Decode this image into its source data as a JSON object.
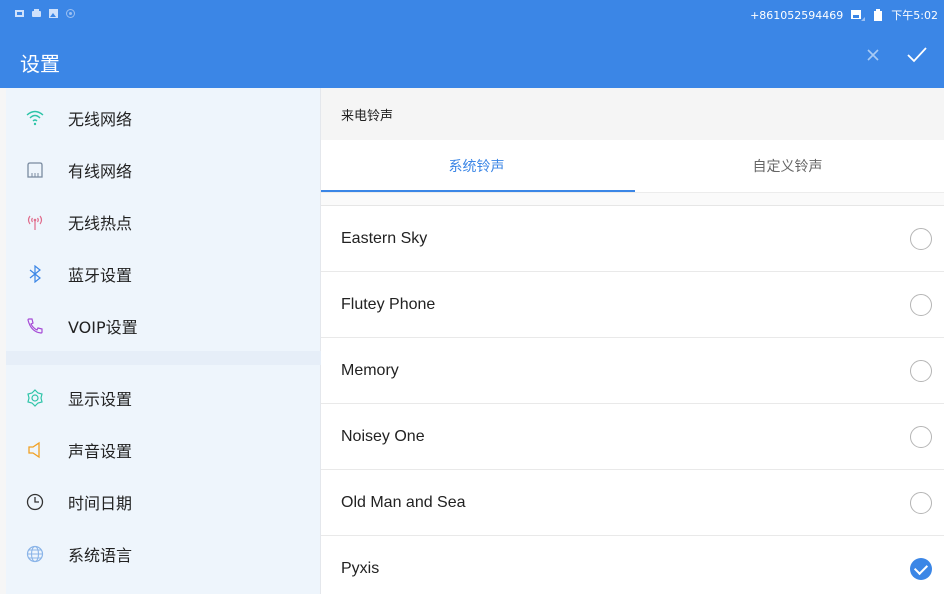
{
  "status_bar": {
    "phone_number": "+861052594469",
    "time": "下午5:02"
  },
  "header": {
    "title": "设置",
    "close_icon": "close-icon",
    "confirm_icon": "check-icon"
  },
  "sidebar": {
    "items": [
      {
        "label": "无线网络",
        "icon": "wifi-icon",
        "color": "#2ec4a8"
      },
      {
        "label": "有线网络",
        "icon": "ethernet-icon",
        "color": "#7a8ba0"
      },
      {
        "label": "无线热点",
        "icon": "hotspot-icon",
        "color": "#e06b8b"
      },
      {
        "label": "蓝牙设置",
        "icon": "bluetooth-icon",
        "color": "#3b86e6"
      },
      {
        "label": "VOIP设置",
        "icon": "phone-icon",
        "color": "#a64ad6"
      },
      {
        "label": "显示设置",
        "icon": "display-icon",
        "color": "#2ec4a8"
      },
      {
        "label": "声音设置",
        "icon": "speaker-icon",
        "color": "#f0a022"
      },
      {
        "label": "时间日期",
        "icon": "clock-icon",
        "color": "#333333"
      },
      {
        "label": "系统语言",
        "icon": "globe-icon",
        "color": "#8ab4e8"
      }
    ]
  },
  "main": {
    "section_title": "来电铃声",
    "tabs": [
      {
        "label": "系统铃声",
        "active": true
      },
      {
        "label": "自定义铃声",
        "active": false
      }
    ],
    "ringtones": [
      {
        "name": "Eastern Sky",
        "selected": false
      },
      {
        "name": "Flutey Phone",
        "selected": false
      },
      {
        "name": "Memory",
        "selected": false
      },
      {
        "name": "Noisey One",
        "selected": false
      },
      {
        "name": "Old Man and Sea",
        "selected": false
      },
      {
        "name": "Pyxis",
        "selected": true
      }
    ]
  },
  "colors": {
    "accent": "#3b86e6"
  }
}
